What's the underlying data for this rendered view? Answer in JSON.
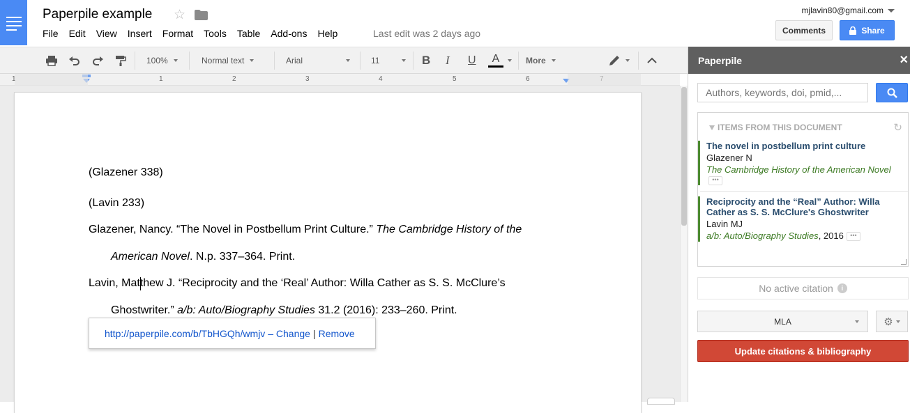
{
  "app": {
    "doc_title": "Paperpile example",
    "account": "mjlavin80@gmail.com",
    "menu": [
      "File",
      "Edit",
      "View",
      "Insert",
      "Format",
      "Tools",
      "Table",
      "Add-ons",
      "Help"
    ],
    "last_edit": "Last edit was 2 days ago",
    "comments_label": "Comments",
    "share_label": "Share"
  },
  "toolbar": {
    "zoom": "100%",
    "style": "Normal text",
    "font": "Arial",
    "size": "11",
    "bold": "B",
    "italic": "I",
    "underline": "U",
    "text_color": "A",
    "more": "More"
  },
  "ruler": {
    "labels": [
      "1",
      "1",
      "2",
      "3",
      "4",
      "5",
      "6",
      "7"
    ]
  },
  "document": {
    "line1": "(Glazener 338)",
    "line2": "(Lavin 233)",
    "bib1_a": "Glazener, Nancy. “The Novel in Postbellum Print Culture.” ",
    "bib1_b": "The Cambridge History of the",
    "bib1_c": "American Novel",
    "bib1_d": ". N.p. 337–364. Print.",
    "bib2_a": "Lavin, Matthew J. “Reciprocity and the ‘Real’ Author: Willa Cather as S. S. McClure’s",
    "bib2_b": "Ghostwriter.” ",
    "bib2_c": "a/b: Auto/Biography Studies",
    "bib2_d": " 31.2 (2016): 233–260. Print.",
    "link_url": "http://paperpile.com/b/TbHGQh/wmjv",
    "link_dash": " – ",
    "link_change": "Change",
    "link_pipe": "|",
    "link_remove": "Remove"
  },
  "sidebar": {
    "title": "Paperpile",
    "close": "×",
    "search_placeholder": "Authors, keywords, doi, pmid,...",
    "items_header": "ITEMS FROM THIS DOCUMENT",
    "items": [
      {
        "title": "The novel in postbellum print culture",
        "author": "Glazener N",
        "journal": "The Cambridge History of the American Novel",
        "year": ""
      },
      {
        "title": "Reciprocity and the “Real” Author: Willa Cather as S. S. McClure's Ghostwriter",
        "author": "Lavin MJ",
        "journal": "a/b: Auto/Biography Studies",
        "year": ", 2016"
      }
    ],
    "no_citation": "No active citation",
    "citation_style": "MLA",
    "update_button": "Update citations & bibliography"
  },
  "colors": {
    "brand_blue": "#4a8af4",
    "update_red": "#d14836",
    "item_border_green": "#4d8b31",
    "sidebar_header": "#5f5f5f"
  }
}
